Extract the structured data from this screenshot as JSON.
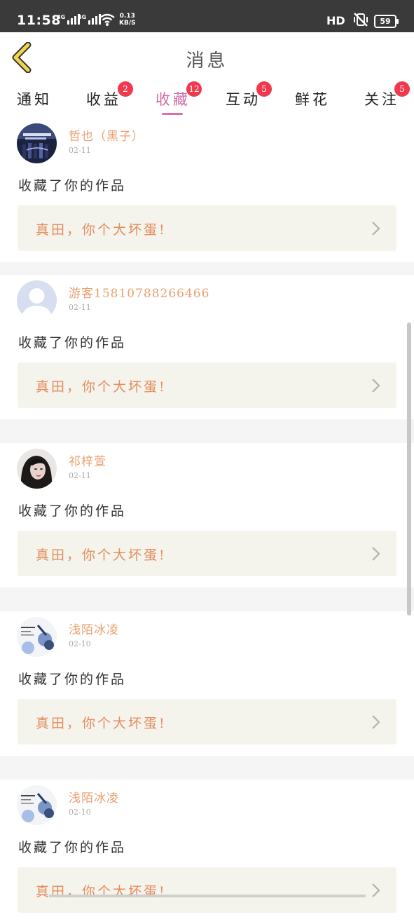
{
  "status_bar": {
    "time": "11:58",
    "signal1_tag": "4G",
    "signal2_tag": "4G",
    "speed_value": "0.13",
    "speed_unit": "KB/S",
    "hd_label": "HD",
    "battery": "59"
  },
  "header": {
    "title": "消息",
    "back_icon": "chevron-left-icon"
  },
  "tabs": [
    {
      "label": "通知",
      "badge": ""
    },
    {
      "label": "收益",
      "badge": "2"
    },
    {
      "label": "收藏",
      "badge": "12",
      "active": true
    },
    {
      "label": "互动",
      "badge": "5"
    },
    {
      "label": "鲜花",
      "badge": ""
    },
    {
      "label": "关注",
      "badge": "5"
    }
  ],
  "feed": [
    {
      "username": "哲也（黑子）",
      "date": "02-11",
      "action": "收藏了你的作品",
      "work_title": "真田，你个大坏蛋!"
    },
    {
      "username": "游客15810788266466",
      "date": "02-11",
      "action": "收藏了你的作品",
      "work_title": "真田，你个大坏蛋!"
    },
    {
      "username": "祁梓萱",
      "date": "02-11",
      "action": "收藏了你的作品",
      "work_title": "真田，你个大坏蛋!"
    },
    {
      "username": "浅陌冰凌",
      "date": "02-10",
      "action": "收藏了你的作品",
      "work_title": "真田，你个大坏蛋!"
    },
    {
      "username": "浅陌冰凌",
      "date": "02-10",
      "action": "收藏了你的作品",
      "work_title": "真田，你个大坏蛋!"
    }
  ],
  "colors": {
    "accent_pink": "#d36aa7",
    "username_orange": "#e8a070",
    "work_title_orange": "#e58b5c",
    "badge_red": "#f0394d",
    "back_arrow_yellow": "#f3d34a"
  }
}
